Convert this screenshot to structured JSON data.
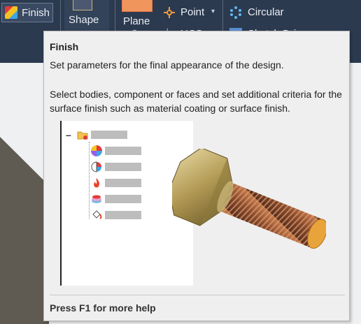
{
  "ribbon": {
    "finish_label": "Finish",
    "shape_label": "Shape",
    "plane_label": "Plane",
    "point_label": "Point",
    "ucs_label": "UCS",
    "circular_label": "Circular",
    "sketch_label": "Sketch Dri",
    "background_color": "#2c3a4f"
  },
  "tooltip": {
    "title": "Finish",
    "summary": "Set parameters for the final appearance of the design.",
    "detail": "Select bodies, component or faces and set additional criteria for the surface finish such as material coating or surface finish.",
    "help": "Press F1 for more help"
  },
  "illustration": {
    "tree_nodes": [
      "folder-icon",
      "color-wheel-icon",
      "color-pie-icon",
      "flame-icon",
      "paint-layers-icon",
      "paint-bucket-icon"
    ],
    "object": "hex-bolt"
  }
}
